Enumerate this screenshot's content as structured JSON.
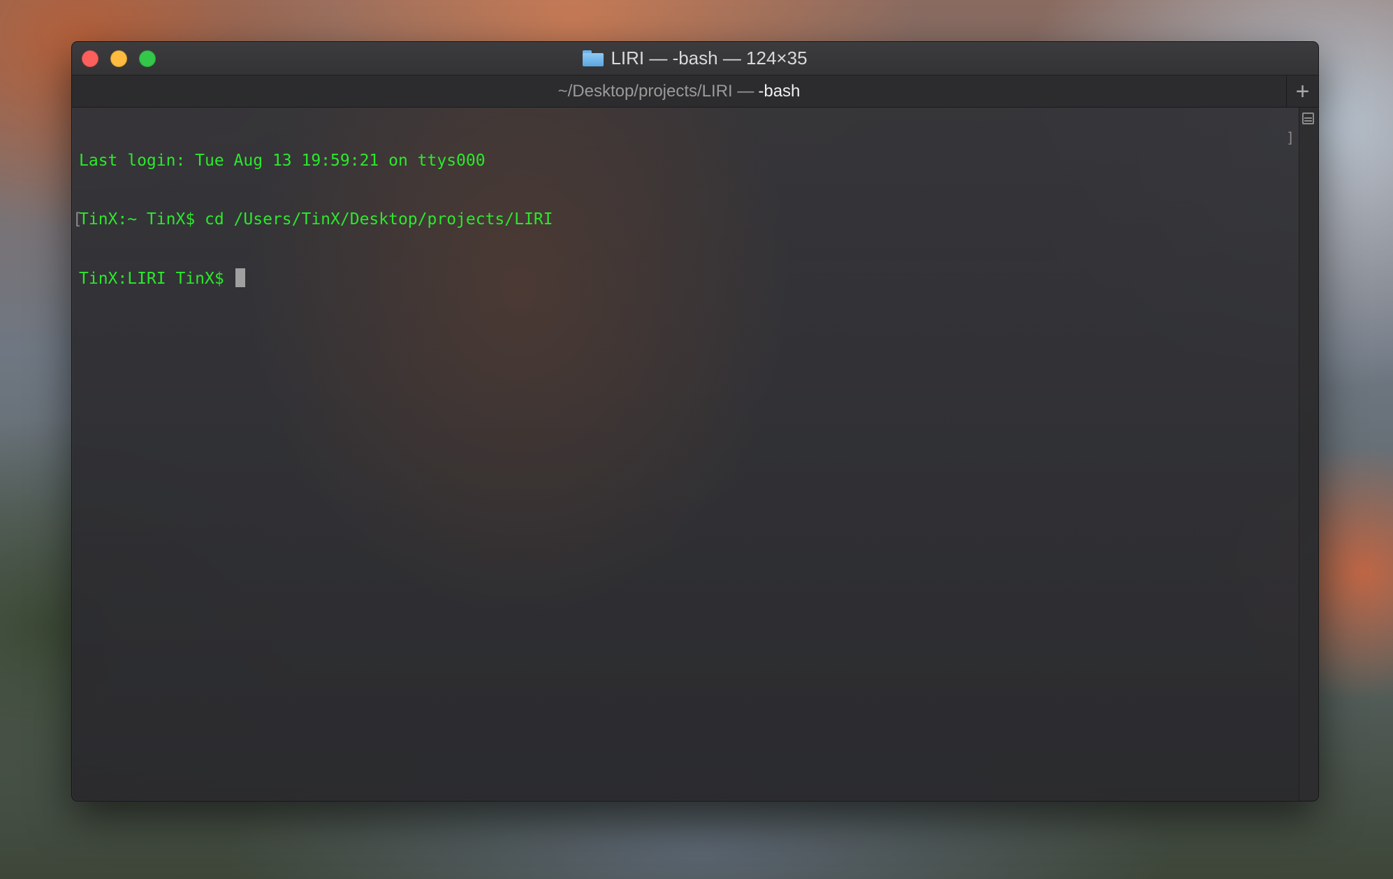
{
  "window": {
    "title": "LIRI — -bash — 124×35",
    "tab": {
      "path": "~/Desktop/projects/LIRI —",
      "process": "-bash"
    },
    "add_tab_label": "+"
  },
  "terminal": {
    "text_color": "#2ce82c",
    "lines": [
      "Last login: Tue Aug 13 19:59:21 on ttys000",
      "TinX:~ TinX$ cd /Users/TinX/Desktop/projects/LIRI",
      "TinX:LIRI TinX$ "
    ],
    "mark_left": "[",
    "mark_right": "]"
  },
  "icons": {
    "title_icon": "folder-icon",
    "add_tab": "plus-icon",
    "split": "split-pane-icon"
  },
  "colors": {
    "close": "#fc605c",
    "minimize": "#fdbc40",
    "maximize": "#34c84a"
  }
}
